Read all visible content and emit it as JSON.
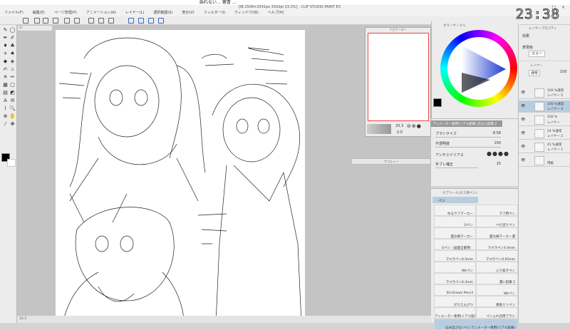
{
  "window": {
    "notification": "語れない… 響書 …",
    "title": "[IB 2508×3541px 350dpi 33.3%] - CLIP STUDIO PAINT EX",
    "controls": "_ □ ×"
  },
  "clock": "23:38",
  "menu": [
    "ファイル(F)",
    "編集(E)",
    "ページ管理(P)",
    "アニメーション(A)",
    "レイヤー(L)",
    "選択範囲(S)",
    "表示(V)",
    "フィルター(I)",
    "ウィンドウ(W)",
    "ヘルプ(H)"
  ],
  "doc_tab": "IB",
  "navigator": {
    "title": "ナビゲーター",
    "zoom": "33.3",
    "rotation": "0.0"
  },
  "subview": {
    "title": "サブビュー"
  },
  "color_panel": {
    "title": "カラーサークル",
    "hue_accent": "#3050c0"
  },
  "tool_property": {
    "header": "アニメーター専用(リアル鉛筆) 応力入鉛筆 2",
    "settings": [
      {
        "label": "ブラシサイズ",
        "value": "8.58"
      },
      {
        "label": "不透明度",
        "value": "100"
      },
      {
        "label": "アンチエイリアス",
        "value": ""
      },
      {
        "label": "手ブレ補正",
        "value": "15"
      }
    ]
  },
  "sub_tool": {
    "title": "サブツール[ガス用ペン]",
    "group": "ペン",
    "brushes": [
      "ゆるラフマーカー",
      "ラフ用ペン",
      "Gペン",
      "べた塗りペン",
      "面な線マーカー",
      "面な線マーカー濃",
      "Gペン（画面全書用）",
      "マメ汁ペン4.0mm",
      "マメ汁ペン0.5mm",
      "マメ汁ペン0.05mm",
      "Wkペン",
      "入り抜きペン",
      "マメ汁ペン0.3mm",
      "濃い鉛筆 2",
      "SU-Dream Pencil",
      "Wkペン",
      "がさえんぴつ",
      "黄昏ミリペン",
      "アニメーター専用(リアル鉛筆)",
      "ペン入れ汎用ブラシ",
      "はみ出さないペンアニメーター専用(リアル鉛筆)"
    ]
  },
  "layer_property": {
    "title": "レイヤープロパティ",
    "effect_label": "効果",
    "color_label": "表現色",
    "color_value": "カラー"
  },
  "layers": {
    "tab": "レイヤー",
    "blend": "通常",
    "opacity": "100",
    "items": [
      {
        "mode": "100 %通常",
        "name": "レイヤー 5"
      },
      {
        "mode": "100 %通常",
        "name": "レイヤー 4",
        "selected": true
      },
      {
        "mode": "100 %",
        "name": "レイヤー"
      },
      {
        "mode": "24 %通常",
        "name": "レイヤー 2"
      },
      {
        "mode": "41 %通常",
        "name": "レイヤー 1"
      },
      {
        "mode": "",
        "name": "用紙"
      }
    ]
  },
  "status": "33.3"
}
